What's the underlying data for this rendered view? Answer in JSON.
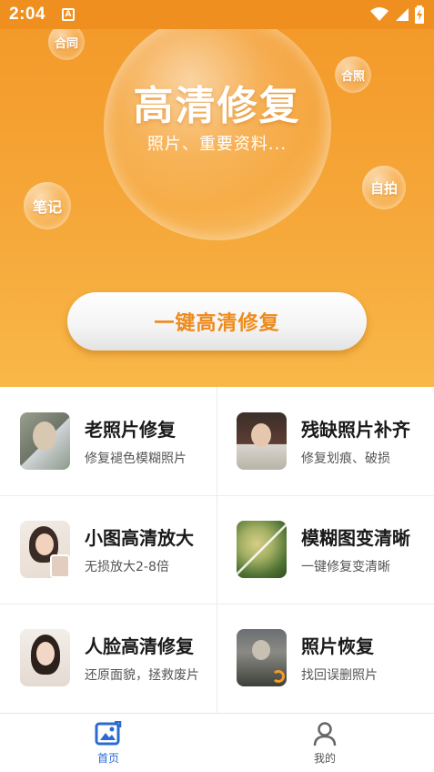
{
  "status_bar": {
    "time": "2:04",
    "notification_icon": "a-notification-icon",
    "icons": [
      "wifi-icon",
      "signal-icon",
      "battery-charging-icon"
    ]
  },
  "hero": {
    "title": "高清修复",
    "subtitle": "照片、重要资料...",
    "bubbles": {
      "contract": "合同",
      "group_photo": "合照",
      "notes": "笔记",
      "selfie": "自拍"
    },
    "main_button": "一键高清修复"
  },
  "features": [
    {
      "title": "老照片修复",
      "desc": "修复褪色模糊照片"
    },
    {
      "title": "残缺照片补齐",
      "desc": "修复划痕、破损"
    },
    {
      "title": "小图高清放大",
      "desc": "无损放大2-8倍"
    },
    {
      "title": "模糊图变清晰",
      "desc": "一键修复变清晰"
    },
    {
      "title": "人脸高清修复",
      "desc": "还原面貌，拯救废片"
    },
    {
      "title": "照片恢复",
      "desc": "找回误删照片"
    }
  ],
  "tabbar": {
    "home": "首页",
    "mine": "我的"
  },
  "colors": {
    "accent": "#f39a2a",
    "button_text": "#ee8a1a",
    "tab_active": "#2a6bd1"
  }
}
